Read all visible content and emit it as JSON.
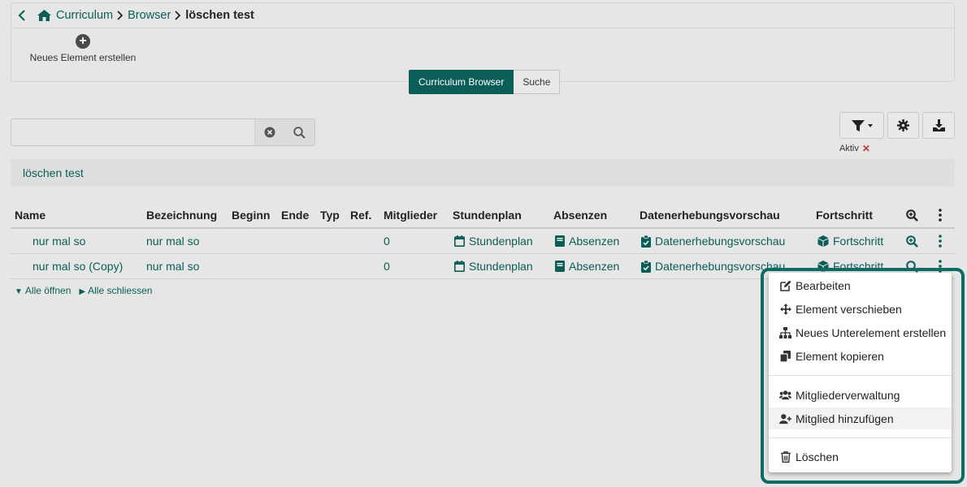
{
  "breadcrumb": {
    "items": [
      "Curriculum",
      "Browser"
    ],
    "current": "löschen test"
  },
  "toolbar": {
    "new_element_label": "Neues Element erstellen"
  },
  "view_tabs": [
    "Curriculum Browser",
    "Suche"
  ],
  "search": {
    "value": "",
    "placeholder": ""
  },
  "filter": {
    "status_label": "Aktiv"
  },
  "context": {
    "title": "löschen test"
  },
  "table": {
    "columns": [
      "Name",
      "Bezeichnung",
      "Beginn",
      "Ende",
      "Typ",
      "Ref.",
      "Mitglieder",
      "Stundenplan",
      "Absenzen",
      "Datenerhebungsvorschau",
      "Fortschritt"
    ],
    "rows": [
      {
        "name": "nur mal so",
        "bezeichnung": "nur mal so",
        "mitglieder": "0",
        "stundenplan": "Stundenplan",
        "absenzen": "Absenzen",
        "daten": "Datenerhebungsvorschau",
        "fortschritt": "Fortschritt"
      },
      {
        "name": "nur mal so (Copy)",
        "bezeichnung": "nur mal so",
        "mitglieder": "0",
        "stundenplan": "Stundenplan",
        "absenzen": "Absenzen",
        "daten": "Datenerhebungsvorschau",
        "fortschritt": "Fortschritt"
      }
    ]
  },
  "tree_links": {
    "open_all": "Alle öffnen",
    "close_all": "Alle schliessen"
  },
  "menu": {
    "items": [
      "Bearbeiten",
      "Element verschieben",
      "Neues Unterelement erstellen",
      "Element kopieren",
      "Mitgliederverwaltung",
      "Mitglied hinzufügen",
      "Löschen"
    ]
  },
  "colors": {
    "accent": "#0a5e57",
    "background": "#e6e6e6",
    "remove": "#c0392b"
  },
  "icons": [
    "chevron-left-icon",
    "home-icon",
    "plus-circle-icon",
    "clear-icon",
    "search-icon",
    "filter-icon",
    "gear-icon",
    "download-icon",
    "calendar-icon",
    "book-icon",
    "clipboard-icon",
    "cube-icon",
    "zoom-icon",
    "kebab-icon",
    "edit-icon",
    "move-icon",
    "sitemap-icon",
    "copy-icon",
    "users-icon",
    "user-plus-icon",
    "trash-icon"
  ]
}
